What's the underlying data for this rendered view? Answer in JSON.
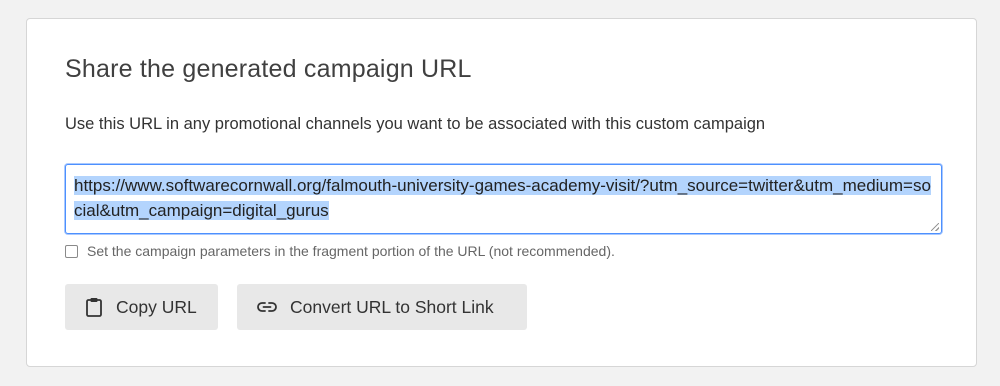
{
  "panel": {
    "title": "Share the generated campaign URL",
    "description": "Use this URL in any promotional channels you want to be associated with this custom campaign"
  },
  "generated_url": {
    "value": "https://www.softwarecornwall.org/falmouth-university-games-academy-visit/?utm_source=twitter&utm_medium=social&utm_campaign=digital_gurus",
    "selected": true
  },
  "fragment_option": {
    "label": "Set the campaign parameters in the fragment portion of the URL (not recommended).",
    "checked": false
  },
  "actions": {
    "copy_label": "Copy URL",
    "copy_icon": "clipboard-icon",
    "short_link_label": "Convert URL to Short Link",
    "short_link_icon": "link-icon"
  },
  "colors": {
    "focus_border": "#4d90fe",
    "selection": "#b3d4fd",
    "button_bg": "#e8e8e8"
  }
}
